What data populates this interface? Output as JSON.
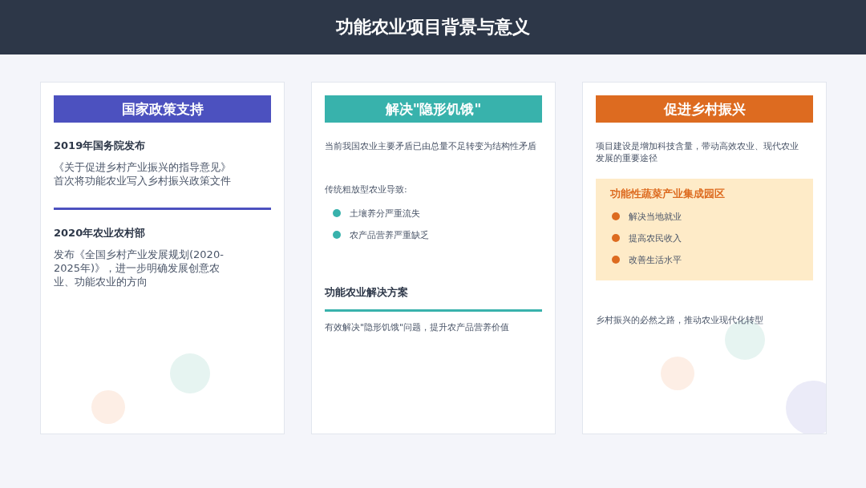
{
  "header": {
    "title": "功能农业项目背景与意义"
  },
  "cards": [
    {
      "heading": "国家政策支持",
      "color": "#4c51bf",
      "blocks": [
        {
          "kind": "subheading",
          "text": "2019年国务院发布"
        },
        {
          "kind": "text",
          "text": "《关于促进乡村产业振兴的指导意见》首次将功能农业写入乡村振兴政策文件"
        },
        {
          "kind": "rule"
        },
        {
          "kind": "subheading",
          "text": "2020年农业农村部"
        },
        {
          "kind": "text",
          "text": "发布《全国乡村产业发展规划(2020-2025年)》，进一步明确发展创意农业、功能农业的方向"
        }
      ]
    },
    {
      "heading": "解决\"隐形饥饿\"",
      "color": "#38b2ac",
      "blocks": [
        {
          "kind": "note",
          "text": "当前我国农业主要矛盾已由总量不足转变为结构性矛盾"
        },
        {
          "kind": "note",
          "text": "传统粗放型农业导致:"
        },
        {
          "kind": "bullets",
          "items": [
            "土壤养分严重流失",
            "农产品营养严重缺乏"
          ]
        },
        {
          "kind": "subheading",
          "text": "功能农业解决方案"
        },
        {
          "kind": "rule"
        },
        {
          "kind": "note",
          "text": "有效解决\"隐形饥饿\"问题，提升农产品营养价值"
        }
      ]
    },
    {
      "heading": "促进乡村振兴",
      "color": "#dd6b20",
      "blocks": [
        {
          "kind": "wrapnote",
          "text": "项目建设是增加科技含量，带动高效农业、现代农业发展的重要途径"
        },
        {
          "kind": "panel",
          "title": "功能性蔬菜产业集成园区",
          "items": [
            "解决当地就业",
            "提高农民收入",
            "改善生活水平"
          ]
        },
        {
          "kind": "note",
          "text": "乡村振兴的必然之路，推动农业现代化转型"
        }
      ]
    }
  ]
}
